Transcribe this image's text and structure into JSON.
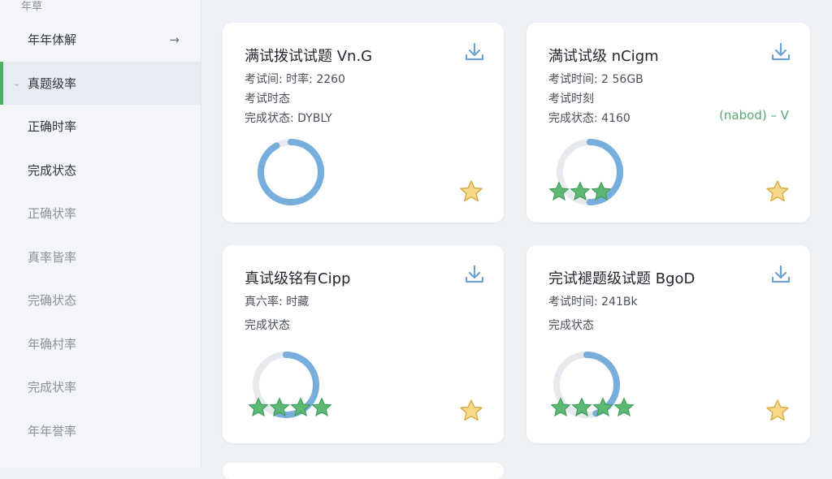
{
  "sidebar": {
    "header": "年草",
    "items": [
      {
        "label": "年年体解"
      },
      {
        "label": "真题级率"
      },
      {
        "label": "正确时率"
      },
      {
        "label": "完成状态"
      },
      {
        "label": "正确状率"
      },
      {
        "label": "真率皆率"
      },
      {
        "label": "完确状态"
      },
      {
        "label": "年确村率"
      },
      {
        "label": "完成状率"
      },
      {
        "label": "年年誉率"
      }
    ],
    "arrow_icon": "arrow-right-icon",
    "chevron_icon": "chevron-down-icon"
  },
  "cards": [
    {
      "title": "满试拨试试题 Vn.G",
      "lines": [
        "考试间: 时率: 2260",
        "考试时态",
        "完成状态: DYBLY"
      ],
      "progress": 0.92,
      "stars_count": 0
    },
    {
      "title": "満试试级 nCigm",
      "lines": [
        "考试时间: 2 56GB",
        "考试时刻",
        "完成状态: 4160"
      ],
      "right_text": "(nabod) – V",
      "progress": 0.5,
      "stars_count": 3
    },
    {
      "title": "真试级铭有Cipp",
      "lines": [
        "真六率: 时藏",
        "完成状态"
      ],
      "progress": 0.55,
      "stars_count": 4
    },
    {
      "title": "完试褪题级试题 BgoD",
      "lines": [
        "考试时间: 241Bk",
        "完成状态"
      ],
      "progress": 0.45,
      "stars_count": 4
    }
  ],
  "icons": {
    "download": "download-icon",
    "favorite": "star-icon"
  },
  "colors": {
    "accent_blue": "#78aedb",
    "accent_green": "#4caf62",
    "star_gold": "#f2c75c",
    "active_bar": "#4caf62"
  }
}
